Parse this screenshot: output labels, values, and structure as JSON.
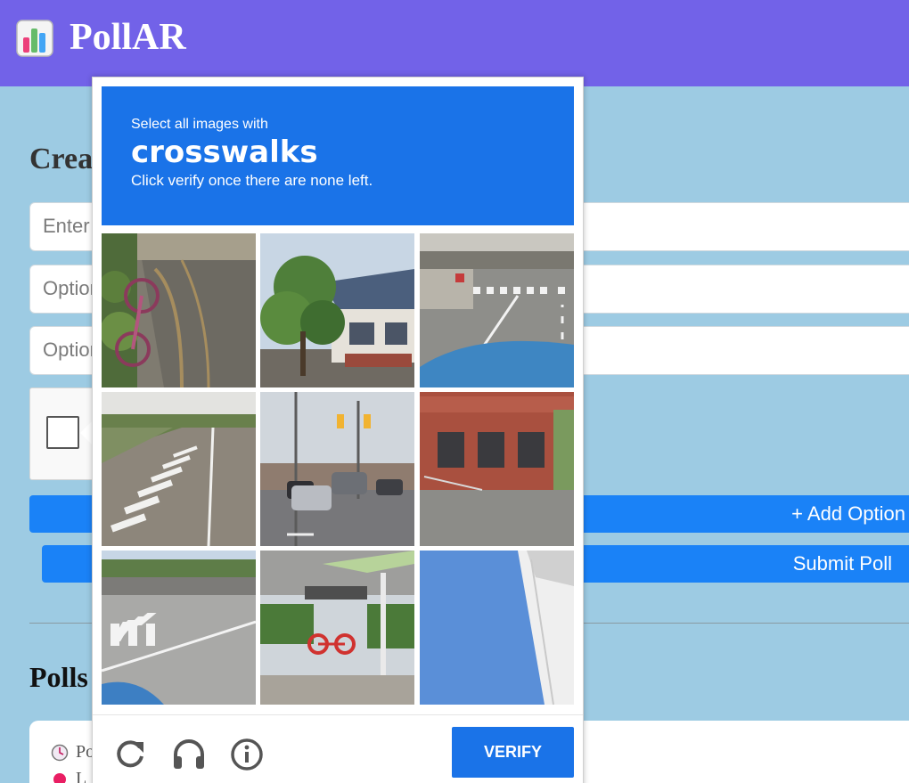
{
  "app": {
    "title": "PollAR"
  },
  "create": {
    "heading": "Creat",
    "question_placeholder": "Enter",
    "option1_placeholder": "Option",
    "option2_placeholder": "Option",
    "add_option_label": "+ Add Option",
    "submit_label": "Submit Poll"
  },
  "polls": {
    "heading": "Polls",
    "rows": [
      "Po",
      "L"
    ]
  },
  "captcha": {
    "instruction": "Select all images with",
    "target": "crosswalks",
    "hint": "Click verify once there are none left.",
    "verify_label": "VERIFY",
    "tiles": [
      "fence-bicycle",
      "house-tree",
      "overpass-crosswalk",
      "road-crosswalk",
      "intersection-traffic-lights",
      "brick-building",
      "intersection-crosswalk",
      "bus-stop-bicycle",
      "building-blue-wall"
    ],
    "footer_icons": [
      "reload-icon",
      "headphones-icon",
      "info-icon"
    ]
  },
  "colors": {
    "header": "#7262e8",
    "page_bg": "#9dcbe3",
    "primary": "#1a82f7",
    "captcha_blue": "#1a73e8"
  }
}
